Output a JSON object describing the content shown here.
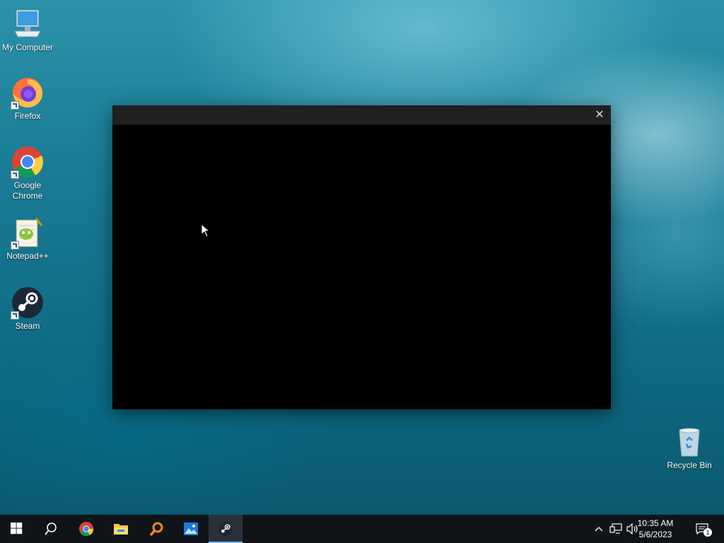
{
  "desktop": {
    "icons": [
      {
        "label": "My Computer"
      },
      {
        "label": "Firefox"
      },
      {
        "label": "Google Chrome"
      },
      {
        "label": "Notepad++"
      },
      {
        "label": "Steam"
      },
      {
        "label": "Recycle Bin"
      }
    ]
  },
  "window": {
    "close_glyph": "✕"
  },
  "taskbar": {
    "clock_time": "10:35 AM",
    "clock_date": "5/6/2023",
    "notification_count": "1"
  },
  "colors": {
    "taskbar_bg": "#101418",
    "window_titlebar": "#202020",
    "active_indicator": "#7cb6e8"
  }
}
